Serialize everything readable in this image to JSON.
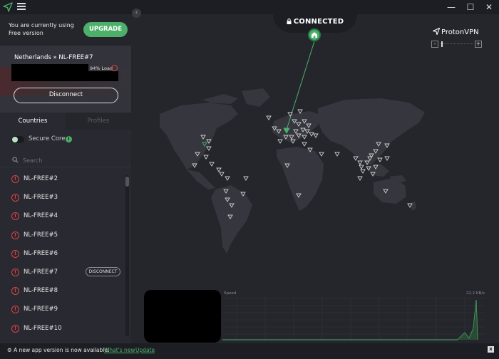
{
  "titlebar": {
    "minimize": "—",
    "maximize": "☐",
    "close": "✕"
  },
  "upgrade": {
    "message": "You are currently using Free version",
    "button": "UPGRADE"
  },
  "connection": {
    "server": "Netherlands » NL-FREE#7",
    "load": "94% Load",
    "disconnect": "Disconnect"
  },
  "tabs": {
    "countries": "Countries",
    "profiles": "Profiles"
  },
  "secure_core": {
    "label": "Secure Core",
    "enabled": false
  },
  "search": {
    "placeholder": "Search"
  },
  "servers": [
    {
      "name": "NL-FREE#2"
    },
    {
      "name": "NL-FREE#3"
    },
    {
      "name": "NL-FREE#4"
    },
    {
      "name": "NL-FREE#5"
    },
    {
      "name": "NL-FREE#6"
    },
    {
      "name": "NL-FREE#7",
      "action": "DISCONNECT"
    },
    {
      "name": "NL-FREE#8"
    },
    {
      "name": "NL-FREE#9"
    },
    {
      "name": "NL-FREE#10"
    }
  ],
  "map": {
    "status": "CONNECTED",
    "brand": "ProtonVPN",
    "zoom_minus": "-",
    "zoom_plus": "+"
  },
  "speed": {
    "label": "Speed",
    "value": "22.2 KB/s"
  },
  "notification": {
    "text": "A new app version is now available!",
    "whats_new": "What's new",
    "update": "Update",
    "close": "x"
  },
  "colors": {
    "accent": "#4caf6a",
    "warning": "#dd4444",
    "background": "#25262c"
  }
}
